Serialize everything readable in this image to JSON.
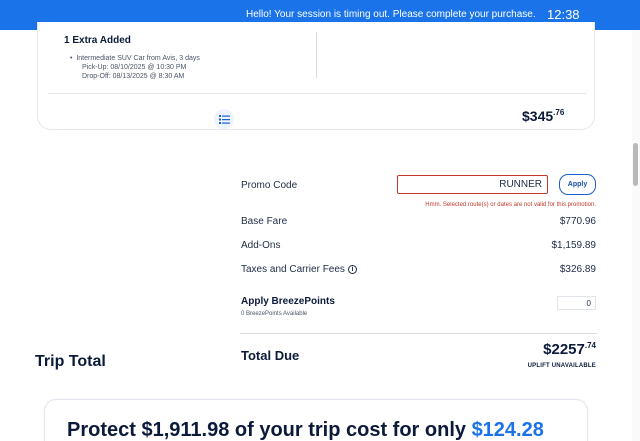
{
  "banner": {
    "message": "Hello! Your session is timing out. Please complete your purchase.",
    "time": "12:38",
    "color": "#1a73e8"
  },
  "extras": {
    "title": "1 Extra Added",
    "item": "Intermediate SUV Car from Avis, 3 days",
    "pickup": "Pick-Up: 08/10/2025 @ 10:30 PM",
    "dropoff": "Drop-Off: 08/13/2025 @ 8:30 AM",
    "price_main": "$345",
    "price_cents": ".76",
    "list_icon": "list-icon"
  },
  "promo": {
    "label": "Promo Code",
    "value": "RUNNER",
    "apply_label": "Apply",
    "error": "Hmm. Selected route(s) or dates are not valid for this promotion.",
    "error_color": "#c0392b"
  },
  "fees": {
    "base_fare_label": "Base Fare",
    "base_fare_value": "$770.96",
    "addons_label": "Add-Ons",
    "addons_value": "$1,159.89",
    "taxes_label": "Taxes and Carrier Fees",
    "taxes_value": "$326.89",
    "info_icon": "info-icon"
  },
  "breezepoints": {
    "label": "Apply BreezePoints",
    "available": "0 BreezePoints Available",
    "value": "0"
  },
  "totals": {
    "trip_total": "Trip Total",
    "total_due_label": "Total Due",
    "amount_main": "$2257",
    "amount_cents": ".74",
    "uplift": "UPLIFT UNAVAILABLE"
  },
  "protection": {
    "text_prefix": "Protect $1,911.98 of your trip cost for only ",
    "price": "$124.28",
    "price_color": "#1a73e8"
  }
}
